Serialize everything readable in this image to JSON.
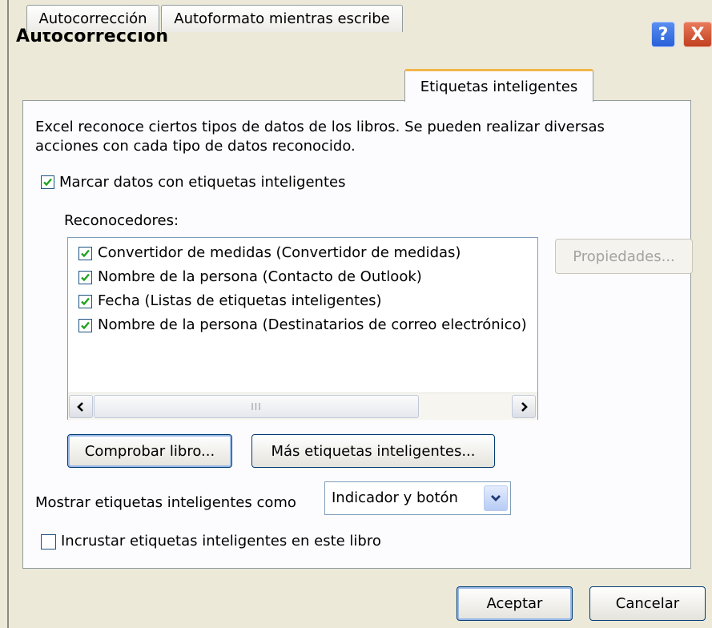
{
  "window": {
    "title": "Autocorrección"
  },
  "title_buttons": {
    "help": "?",
    "close": "X"
  },
  "tabs": [
    {
      "label": "Autocorrección",
      "active": false
    },
    {
      "label": "Autoformato mientras escribe",
      "active": false
    },
    {
      "label": "Etiquetas inteligentes",
      "active": true
    }
  ],
  "panel": {
    "description_line1": "Excel reconoce ciertos tipos de datos de los libros. Se pueden realizar diversas",
    "description_line2": "acciones con cada tipo de datos reconocido.",
    "mark_data_checkbox": {
      "label": "Marcar datos con etiquetas inteligentes",
      "checked": true
    },
    "recognizers_label": "Reconocedores:",
    "recognizers": [
      {
        "label": "Convertidor de medidas (Convertidor de medidas)",
        "checked": true
      },
      {
        "label": "Nombre de la persona (Contacto de Outlook)",
        "checked": true
      },
      {
        "label": "Fecha (Listas de etiquetas inteligentes)",
        "checked": true
      },
      {
        "label": "Nombre de la persona (Destinatarios de correo electrónico)",
        "checked": true
      }
    ],
    "scrollbar_grip": "III",
    "properties_button": "Propiedades...",
    "check_book_button": "Comprobar libro...",
    "more_tags_button": "Más etiquetas inteligentes...",
    "show_as_label": "Mostrar etiquetas inteligentes como",
    "show_as_value": "Indicador y botón",
    "embed_checkbox": {
      "label": "Incrustar etiquetas inteligentes en este libro",
      "checked": false
    }
  },
  "footer": {
    "ok_button": "Aceptar",
    "cancel_button": "Cancelar"
  },
  "colors": {
    "dialog_bg": "#ece9d8",
    "active_tab_accent": "#f3b64b",
    "check_green": "#21a121",
    "button_border": "#003c74"
  }
}
